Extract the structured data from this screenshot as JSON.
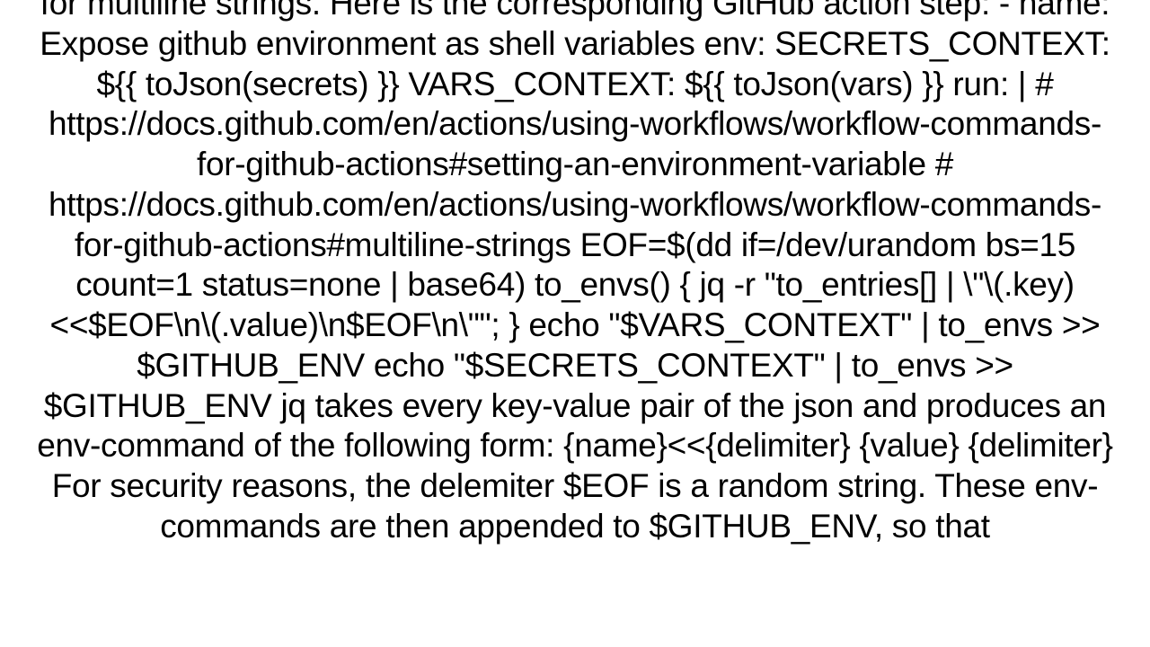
{
  "document": {
    "body_text": "for multiline strings. Here is the corresponding GitHub action step: - name: Expose github environment as shell variables   env:     SECRETS_CONTEXT: ${{ toJson(secrets) }}     VARS_CONTEXT: ${{ toJson(vars) }}   run: |     # https://docs.github.com/en/actions/using-workflows/workflow-commands-for-github-actions#setting-an-environment-variable     # https://docs.github.com/en/actions/using-workflows/workflow-commands-for-github-actions#multiline-strings     EOF=$(dd if=/dev/urandom bs=15 count=1 status=none | base64)     to_envs() { jq -r \"to_entries[] | \\\"\\(.key)<<$EOF\\n\\(.value)\\n$EOF\\n\\\"\"; }     echo \"$VARS_CONTEXT\" | to_envs >> $GITHUB_ENV     echo \"$SECRETS_CONTEXT\" | to_envs >> $GITHUB_ENV  jq takes every key-value pair of the json and produces an env-command of the following form: {name}<<{delimiter} {value} {delimiter}  For security reasons, the delemiter $EOF is a random string. These env-commands are then appended to $GITHUB_ENV, so that"
  }
}
